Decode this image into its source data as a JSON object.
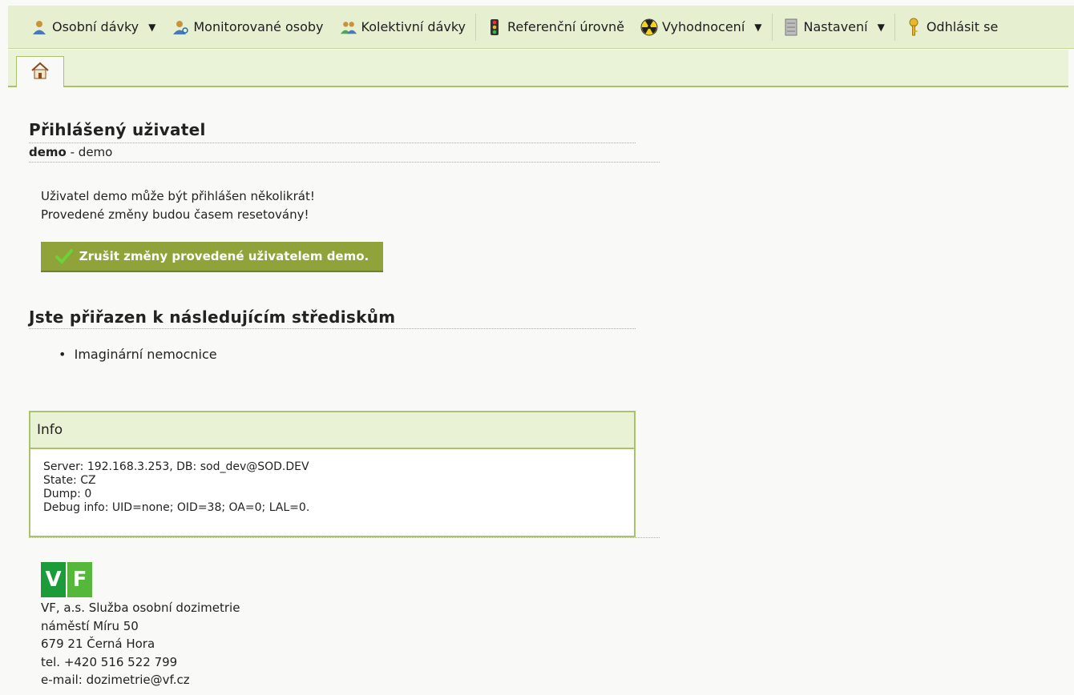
{
  "menu": {
    "items": [
      {
        "label": "Osobní dávky",
        "icon": "person-icon",
        "dropdown": true
      },
      {
        "label": "Monitorované osoby",
        "icon": "person-search-icon",
        "dropdown": false
      },
      {
        "label": "Kolektivní dávky",
        "icon": "group-icon",
        "dropdown": false
      },
      {
        "label": "Referenční úrovně",
        "icon": "traffic-light-icon",
        "dropdown": false
      },
      {
        "label": "Vyhodnocení",
        "icon": "radiation-icon",
        "dropdown": true
      },
      {
        "label": "Nastavení",
        "icon": "server-icon",
        "dropdown": true
      },
      {
        "label": "Odhlásit se",
        "icon": "key-icon",
        "dropdown": false
      }
    ]
  },
  "user_section": {
    "title": "Přihlášený uživatel",
    "username": "demo",
    "name_suffix": " - demo",
    "notice_line1": "Uživatel demo může být přihlášen několikrát!",
    "notice_line2": "Provedené změny budou časem resetovány!",
    "reset_button": "Zrušit změny provedené uživatelem demo."
  },
  "centers_section": {
    "title": "Jste přiřazen k následujícím střediskům",
    "items": [
      "Imaginární nemocnice"
    ]
  },
  "info": {
    "title": "Info",
    "line1": "Server: 192.168.3.253, DB: sod_dev@SOD.DEV",
    "line2": "State: CZ",
    "line3": "Dump: 0",
    "line4": "Debug info: UID=none; OID=38; OA=0; LAL=0."
  },
  "footer": {
    "logo_v": "V",
    "logo_f": "F",
    "line1": "VF, a.s. Služba osobní dozimetrie",
    "line2": "náměstí Míru 50",
    "line3": "679 21 Černá Hora",
    "line4": "tel. +420 516 522 799",
    "line5": "e-mail: dozimetrie@vf.cz"
  },
  "colors": {
    "accent": "#8fa33a",
    "menu_bg": "#e6f0d1",
    "border": "#a9c26b"
  }
}
